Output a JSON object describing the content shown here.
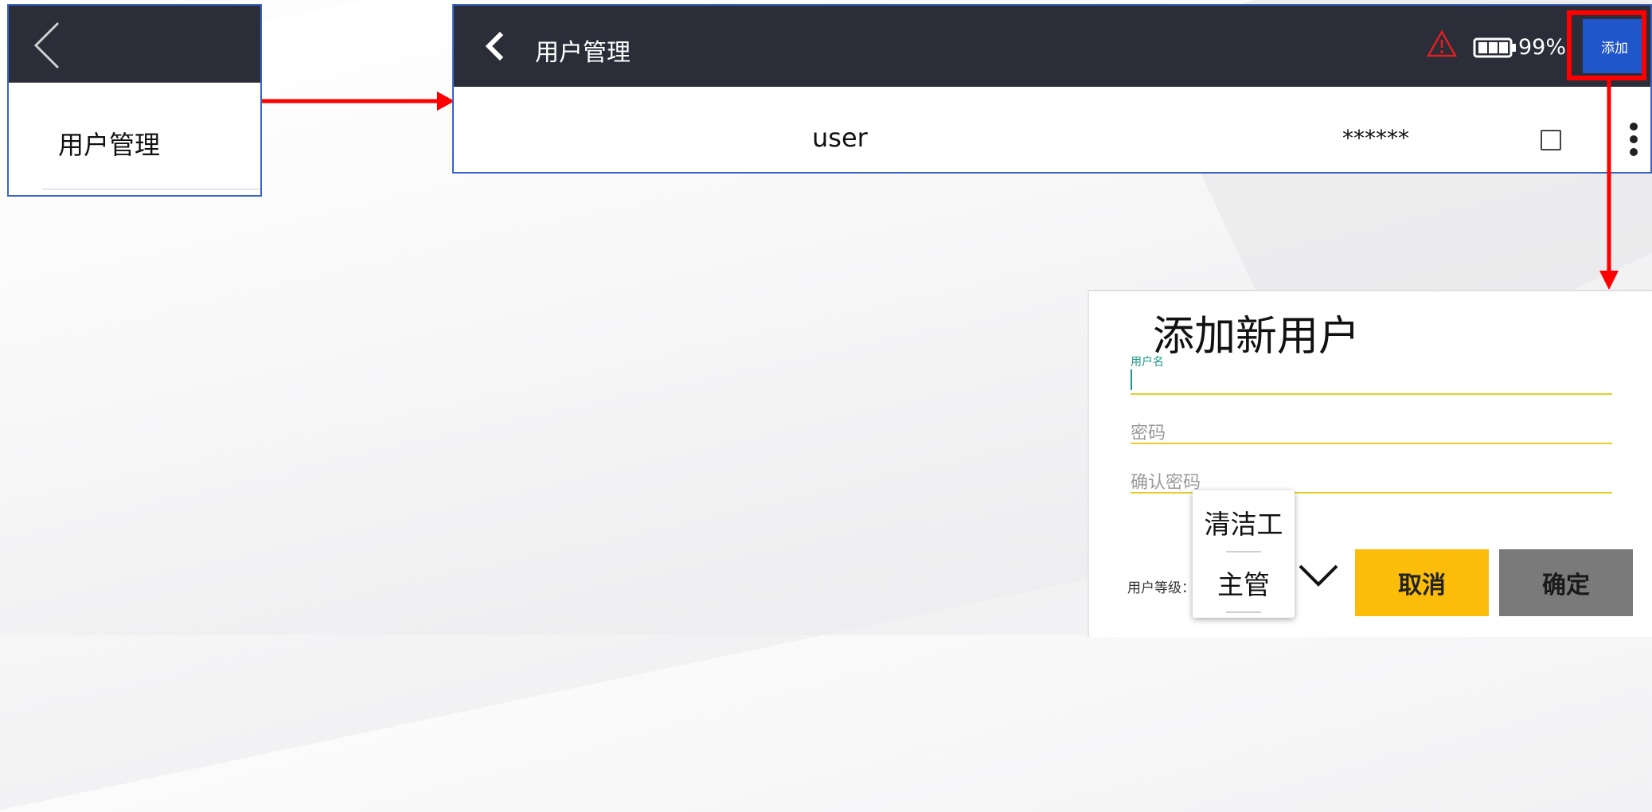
{
  "panel1": {
    "label": "用户管理"
  },
  "panel2": {
    "title": "用户管理",
    "battery_percent": "99%",
    "add_label": "添加",
    "row": {
      "username": "user",
      "password": "******"
    }
  },
  "dialog": {
    "title": "添加新用户",
    "username_label": "用户名",
    "password_placeholder": "密码",
    "confirm_password_placeholder": "确认密码",
    "level_label": "用户等级：",
    "level_options": [
      "清洁工",
      "主管"
    ],
    "cancel_label": "取消",
    "confirm_label": "确定"
  },
  "colors": {
    "header": "#2b2d38",
    "accent_blue": "#1f56c9",
    "highlight_red": "#ff0000",
    "cancel_yellow": "#fbbd0a",
    "confirm_gray": "#7a7a7a",
    "field_underline": "#e4cf2a"
  },
  "icons": [
    "back-icon",
    "warning-icon",
    "battery-icon",
    "more-vert-icon",
    "chevron-down-icon"
  ]
}
